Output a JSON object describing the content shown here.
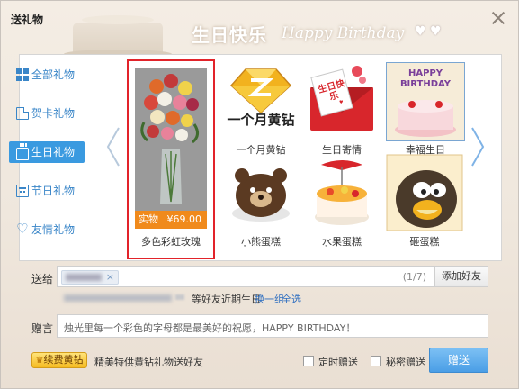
{
  "window": {
    "title": "送礼物",
    "banner_cn": "生日快乐",
    "banner_en": "Happy Birthday",
    "banner_hearts": "♥ ♥"
  },
  "sidebar": {
    "items": [
      {
        "label": "全部礼物",
        "icon": "grid-icon",
        "active": false
      },
      {
        "label": "贺卡礼物",
        "icon": "card-icon",
        "active": false
      },
      {
        "label": "生日礼物",
        "icon": "cake-icon",
        "active": true
      },
      {
        "label": "节日礼物",
        "icon": "calendar-icon",
        "active": false
      },
      {
        "label": "友情礼物",
        "icon": "heart-icon",
        "active": false
      }
    ]
  },
  "featured_gift": {
    "name": "多色彩虹玫瑰",
    "tag": "实物",
    "price": "¥69.00"
  },
  "gifts": [
    {
      "name": "一个月黄钻",
      "thumb_text": "一个月黄钻",
      "icon": "yellow-diamond-icon"
    },
    {
      "name": "生日寄情",
      "thumb_text": "生日快乐",
      "icon": "birthday-envelope-icon"
    },
    {
      "name": "幸福生日",
      "thumb_text": "HAPPY BIRTHDAY",
      "icon": "birthday-cake-icon",
      "selected": true
    },
    {
      "name": "小熊蛋糕",
      "icon": "bear-cake-icon"
    },
    {
      "name": "水果蛋糕",
      "icon": "fruit-cake-icon"
    },
    {
      "name": "砸蛋糕",
      "icon": "penguin-cake-icon"
    }
  ],
  "form": {
    "recipient_label": "送给",
    "recipient_count": "(1/7)",
    "add_friend": "添加好友",
    "hint_text": "等好友近期生日",
    "hint_link_change": "换一组",
    "hint_link_all": "全选",
    "message_label": "赠言",
    "message_text": "烛光里每一个彩色的字母都是最美好的祝愿，HAPPY BIRTHDAY！",
    "renew_button": "续费黄钻",
    "renew_note": "精美特供黄钻礼物送好友",
    "timed_send": "定时赠送",
    "secret_send": "秘密赠送",
    "send_button": "赠送"
  },
  "colors": {
    "accent_blue": "#3a9ae0",
    "link_blue": "#2f6fc0",
    "price_orange": "#f08a1c",
    "highlight_red": "#e2232a",
    "send_button": "#4a9ee6"
  }
}
